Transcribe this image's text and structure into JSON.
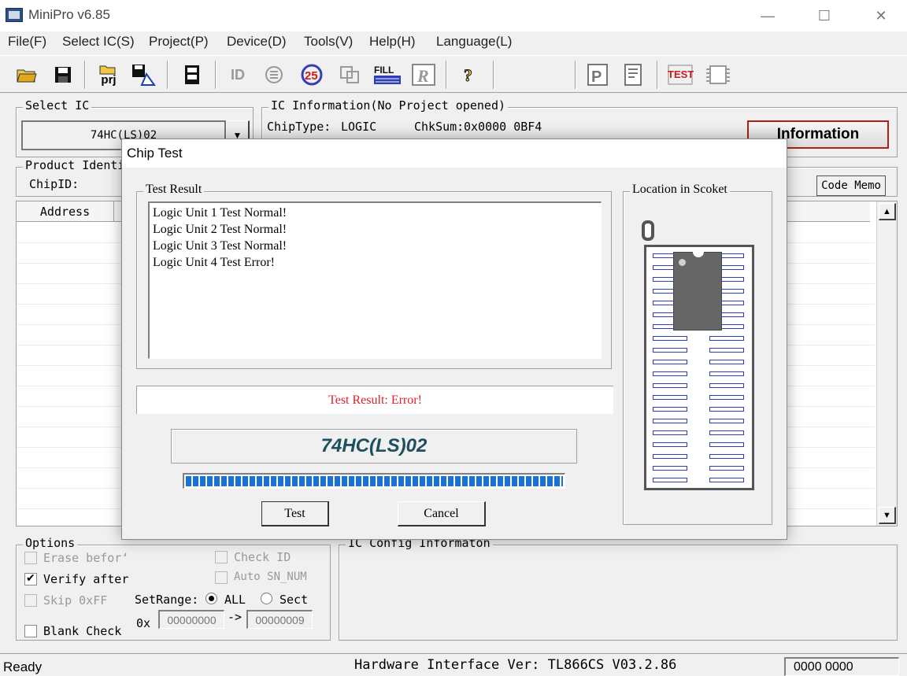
{
  "window": {
    "title": "MiniPro v6.85",
    "minimize": "—",
    "maximize": "☐",
    "close": "✕"
  },
  "menu": [
    "File(F)",
    "Select IC(S)",
    "Project(P)",
    "Device(D)",
    "Tools(V)",
    "Help(H)",
    "Language(L)"
  ],
  "toolbar": {
    "fill": "FILL",
    "test": "TEST",
    "prj": "prj",
    "help": "?"
  },
  "select_ic": {
    "title": "Select IC",
    "value": "74HC(LS)02"
  },
  "ic_info": {
    "title": "IC Information(No Project opened)",
    "chiptype_label": "ChipType:",
    "chiptype_value": "LOGIC",
    "chksum_label": "ChkSum:",
    "chksum_value": "0x0000 0BF4",
    "information_button": "Information"
  },
  "product_identity": {
    "title": "Product Identi",
    "chipid_label": "ChipID:"
  },
  "code_memo_button": "Code Memo",
  "grid": {
    "address_header": "Address"
  },
  "options": {
    "title": "Options",
    "erase_before": "Erase befor‘",
    "verify_after": "Verify after",
    "skip_0xff": "Skip 0xFF",
    "blank_check": "Blank Check",
    "check_id": "Check ID",
    "auto_sn_num": "Auto SN_NUM",
    "setrange_label": "SetRange:",
    "range_all": "ALL",
    "range_sect": "Sect",
    "ox_label": "0x",
    "range_from": "00000000",
    "arrow": "->",
    "range_to": "00000009"
  },
  "ic_config": {
    "title": "IC Config Informaton"
  },
  "statusbar": {
    "status": "Ready",
    "hardware": "Hardware Interface Ver: TL866CS V03.2.86",
    "counter": "0000 0000"
  },
  "dialog": {
    "title": "Chip Test",
    "test_result_title": "Test Result",
    "results": [
      "Logic Unit 1 Test Normal!",
      "Logic Unit 2 Test Normal!",
      "Logic Unit 3 Test Normal!",
      "Logic Unit 4 Test Error!"
    ],
    "summary": "Test Result:  Error!",
    "chip_name": "74HC(LS)02",
    "progress": 1.0,
    "test_button": "Test",
    "cancel_button": "Cancel",
    "location_title": "Location in Scoket"
  },
  "colors": {
    "error_text": "#e0202a",
    "chip_name": "#1e4f5e",
    "progress": "#1a72d9",
    "pin_outline": "#2e3fb0",
    "chip_body": "#666666"
  }
}
